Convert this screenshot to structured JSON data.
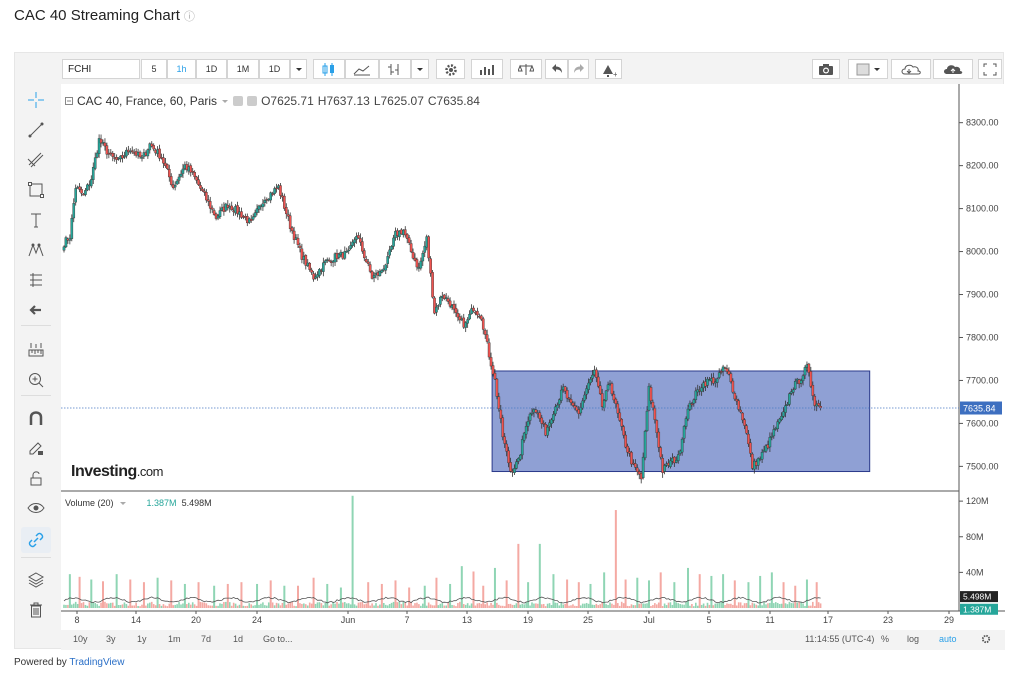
{
  "page": {
    "title": "CAC 40 Streaming Chart",
    "info_icon": "ⓘ",
    "powered_prefix": "Powered by ",
    "powered_brand": "TradingView"
  },
  "toolbar": {
    "symbol": "FCHI",
    "intervals": [
      "5",
      "1h",
      "1D",
      "1M",
      "1D"
    ],
    "active_interval": "1h",
    "icons": [
      "candles-icon",
      "area-icon",
      "bars-icon",
      "gear-icon",
      "indicators-icon",
      "compare-icon",
      "undo-icon",
      "redo-icon",
      "alert-icon",
      "camera-icon",
      "fullscreen-icon"
    ]
  },
  "legend": {
    "name": "CAC 40, France, 60, Paris",
    "open": "O7625.71",
    "high": "H7637.13",
    "low": "L7625.07",
    "close": "C7635.84"
  },
  "volume_legend": {
    "name": "Volume (20)",
    "v1": "1.387M",
    "v2": "5.498M"
  },
  "logo": {
    "brand": "Investing",
    "suffix": ".com"
  },
  "bottom_bar": {
    "ranges": [
      "10y",
      "3y",
      "1y",
      "1m",
      "7d",
      "1d"
    ],
    "goto": "Go to...",
    "time": "11:14:55 (UTC-4)",
    "percent": "%",
    "log": "log",
    "auto": "auto"
  },
  "colors": {
    "up": "#26a69a",
    "down": "#ef5350",
    "wick": "#333333",
    "rect_fill": "#7b8fcc",
    "rect_border": "#2b3a8a",
    "price_line": "#4a79c4",
    "price_label": "#3d6fc0"
  },
  "chart_data": {
    "type": "candlestick",
    "price_axis": {
      "ticks": [
        8300,
        8200,
        8100,
        8000,
        7900,
        7800,
        7700,
        7600,
        7500
      ],
      "labels": [
        "8300.00",
        "8200.00",
        "8100.00",
        "8000.00",
        "7900.00",
        "7800.00",
        "7700.00",
        "7600.00",
        "7500.00"
      ],
      "range": [
        7445,
        8390
      ]
    },
    "time_axis": {
      "labels": [
        "8",
        "14",
        "20",
        "24",
        "Jun",
        "7",
        "13",
        "19",
        "25",
        "Jul",
        "5",
        "11",
        "17",
        "23",
        "29"
      ]
    },
    "current_price": {
      "value": 7635.84,
      "label": "7635.84"
    },
    "rectangle": {
      "price_top": 7722,
      "price_bottom": 7488,
      "from_label": "13",
      "to_label": "23"
    },
    "anchors": [
      [
        0,
        8020
      ],
      [
        3,
        8035
      ],
      [
        6,
        8150
      ],
      [
        10,
        8130
      ],
      [
        14,
        8170
      ],
      [
        18,
        8260
      ],
      [
        24,
        8220
      ],
      [
        28,
        8210
      ],
      [
        34,
        8240
      ],
      [
        40,
        8215
      ],
      [
        44,
        8250
      ],
      [
        50,
        8220
      ],
      [
        56,
        8150
      ],
      [
        62,
        8200
      ],
      [
        66,
        8180
      ],
      [
        72,
        8130
      ],
      [
        78,
        8080
      ],
      [
        84,
        8110
      ],
      [
        90,
        8090
      ],
      [
        96,
        8065
      ],
      [
        102,
        8120
      ],
      [
        110,
        8150
      ],
      [
        116,
        8060
      ],
      [
        122,
        7990
      ],
      [
        128,
        7940
      ],
      [
        134,
        7975
      ],
      [
        140,
        7990
      ],
      [
        146,
        7995
      ],
      [
        150,
        8040
      ],
      [
        154,
        7990
      ],
      [
        158,
        7940
      ],
      [
        162,
        7950
      ],
      [
        166,
        7980
      ],
      [
        170,
        8040
      ],
      [
        174,
        8050
      ],
      [
        178,
        8000
      ],
      [
        182,
        7960
      ],
      [
        186,
        8030
      ],
      [
        190,
        7860
      ],
      [
        194,
        7900
      ],
      [
        198,
        7880
      ],
      [
        202,
        7840
      ],
      [
        206,
        7830
      ],
      [
        210,
        7870
      ],
      [
        214,
        7850
      ],
      [
        218,
        7760
      ],
      [
        221,
        7700
      ],
      [
        225,
        7570
      ],
      [
        229,
        7490
      ],
      [
        233,
        7510
      ],
      [
        237,
        7600
      ],
      [
        241,
        7640
      ],
      [
        247,
        7580
      ],
      [
        251,
        7630
      ],
      [
        256,
        7680
      ],
      [
        260,
        7640
      ],
      [
        264,
        7625
      ],
      [
        268,
        7680
      ],
      [
        272,
        7720
      ],
      [
        276,
        7640
      ],
      [
        280,
        7695
      ],
      [
        284,
        7620
      ],
      [
        288,
        7550
      ],
      [
        292,
        7500
      ],
      [
        296,
        7470
      ],
      [
        300,
        7680
      ],
      [
        303,
        7610
      ],
      [
        307,
        7490
      ],
      [
        311,
        7510
      ],
      [
        315,
        7520
      ],
      [
        319,
        7620
      ],
      [
        323,
        7660
      ],
      [
        327,
        7690
      ],
      [
        331,
        7700
      ],
      [
        335,
        7700
      ],
      [
        338,
        7730
      ],
      [
        341,
        7710
      ],
      [
        345,
        7650
      ],
      [
        349,
        7600
      ],
      [
        353,
        7500
      ],
      [
        357,
        7520
      ],
      [
        361,
        7550
      ],
      [
        365,
        7590
      ],
      [
        369,
        7620
      ],
      [
        373,
        7680
      ],
      [
        377,
        7700
      ],
      [
        381,
        7730
      ],
      [
        385,
        7650
      ],
      [
        388,
        7636
      ]
    ],
    "volume_axis": {
      "ticks": [
        120,
        80,
        40
      ],
      "labels": [
        "120M",
        "80M",
        "40M"
      ],
      "range": [
        0,
        128
      ]
    },
    "volume_labels": {
      "a": "5.498M",
      "b": "1.387M"
    },
    "volume_spikes": [
      [
        3,
        38,
        "up"
      ],
      [
        8,
        35,
        "down"
      ],
      [
        14,
        32,
        "up"
      ],
      [
        20,
        30,
        "down"
      ],
      [
        27,
        38,
        "up"
      ],
      [
        34,
        32,
        "down"
      ],
      [
        41,
        29,
        "down"
      ],
      [
        48,
        34,
        "up"
      ],
      [
        55,
        31,
        "down"
      ],
      [
        62,
        27,
        "up"
      ],
      [
        69,
        29,
        "down"
      ],
      [
        77,
        25,
        "up"
      ],
      [
        84,
        27,
        "down"
      ],
      [
        91,
        29,
        "down"
      ],
      [
        99,
        27,
        "up"
      ],
      [
        106,
        31,
        "down"
      ],
      [
        113,
        25,
        "up"
      ],
      [
        120,
        25,
        "down"
      ],
      [
        128,
        34,
        "down"
      ],
      [
        135,
        27,
        "up"
      ],
      [
        142,
        23,
        "up"
      ],
      [
        148,
        126,
        "up"
      ],
      [
        156,
        29,
        "down"
      ],
      [
        163,
        27,
        "down"
      ],
      [
        170,
        31,
        "down"
      ],
      [
        177,
        23,
        "down"
      ],
      [
        185,
        25,
        "up"
      ],
      [
        191,
        34,
        "down"
      ],
      [
        198,
        27,
        "up"
      ],
      [
        204,
        47,
        "up"
      ],
      [
        210,
        41,
        "down"
      ],
      [
        215,
        25,
        "down"
      ],
      [
        221,
        45,
        "up"
      ],
      [
        227,
        31,
        "down"
      ],
      [
        233,
        72,
        "down"
      ],
      [
        238,
        29,
        "up"
      ],
      [
        244,
        72,
        "up"
      ],
      [
        251,
        38,
        "up"
      ],
      [
        258,
        32,
        "down"
      ],
      [
        264,
        29,
        "down"
      ],
      [
        270,
        27,
        "up"
      ],
      [
        277,
        40,
        "up"
      ],
      [
        283,
        110,
        "down"
      ],
      [
        288,
        32,
        "down"
      ],
      [
        294,
        34,
        "up"
      ],
      [
        300,
        31,
        "up"
      ],
      [
        306,
        40,
        "down"
      ],
      [
        313,
        29,
        "up"
      ],
      [
        320,
        45,
        "up"
      ],
      [
        326,
        38,
        "down"
      ],
      [
        332,
        36,
        "up"
      ],
      [
        338,
        38,
        "up"
      ],
      [
        344,
        31,
        "down"
      ],
      [
        351,
        29,
        "up"
      ],
      [
        357,
        36,
        "up"
      ],
      [
        363,
        40,
        "up"
      ],
      [
        369,
        29,
        "down"
      ],
      [
        375,
        25,
        "down"
      ],
      [
        381,
        32,
        "up"
      ],
      [
        386,
        29,
        "down"
      ]
    ]
  }
}
